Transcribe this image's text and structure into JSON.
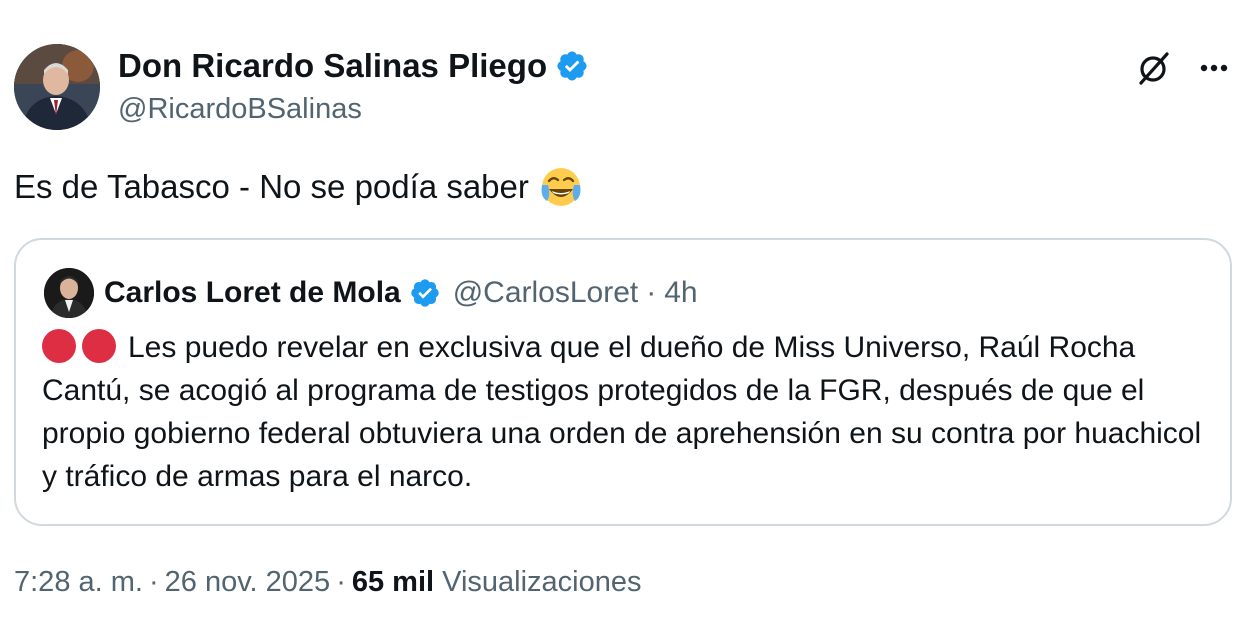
{
  "author": {
    "display_name": "Don Ricardo Salinas Pliego",
    "handle": "@RicardoBSalinas"
  },
  "tweet": {
    "text": "Es de Tabasco - No se podía saber"
  },
  "quoted_tweet": {
    "display_name": "Carlos Loret de Mola",
    "handle": "@CarlosLoret",
    "separator": "·",
    "time_ago": "4h",
    "text": "Les puedo revelar en exclusiva que el dueño de Miss Universo, Raúl Rocha Cantú, se acogió al programa de testigos protegidos de la FGR, después de que el propio gobierno federal obtuviera una orden de aprehensión en su contra por huachicol y tráfico de armas para el narco."
  },
  "meta": {
    "time": "7:28 a. m.",
    "separator": "·",
    "date": "26 nov. 2025",
    "views_count": "65 mil",
    "views_label": "Visualizaciones"
  },
  "icons": {
    "verified": "verified-badge-icon",
    "grok": "grok-icon",
    "more": "more-options-icon",
    "emoji": "face-with-tears-of-joy-emoji",
    "red_circle": "red-circle-emoji"
  },
  "colors": {
    "verified_blue": "#1d9bf0",
    "secondary_text": "#536471",
    "primary_text": "#0f1419",
    "border": "#cfd9de",
    "red_circle": "#dd2e44"
  }
}
